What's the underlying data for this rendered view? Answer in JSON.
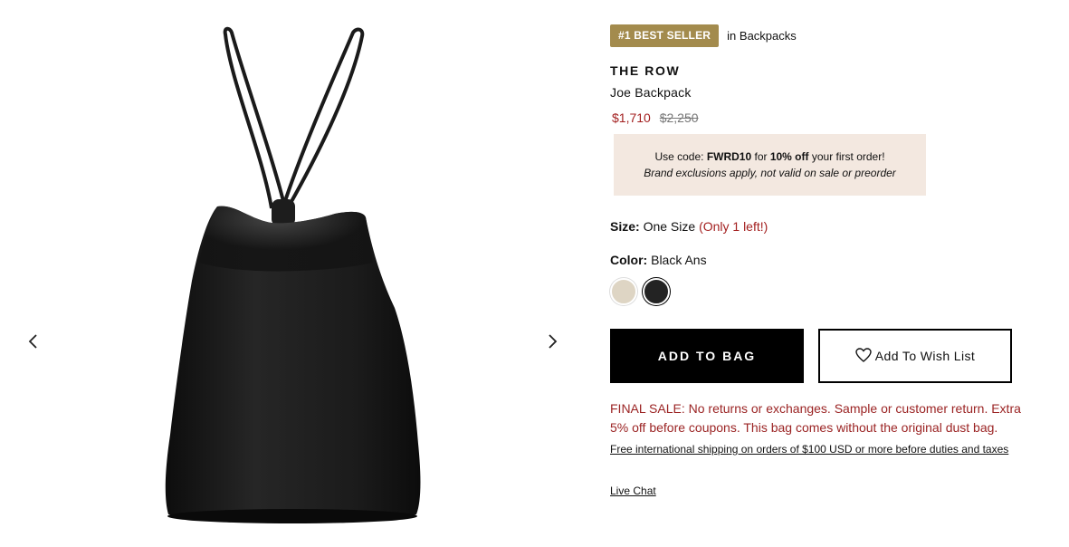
{
  "gallery": {
    "prev_icon": "chevron-left-icon",
    "next_icon": "chevron-right-icon"
  },
  "product": {
    "badge": "#1 BEST SELLER",
    "badge_category": "in Backpacks",
    "brand": "THE ROW",
    "name": "Joe Backpack",
    "price_sale": "$1,710",
    "price_original": "$2,250",
    "promo": {
      "prefix": "Use code: ",
      "code": "FWRD10",
      "middle": " for ",
      "discount": "10% off",
      "suffix": " your first order!",
      "note": "Brand exclusions apply, not valid on sale or preorder"
    },
    "size": {
      "label": "Size:",
      "value": "One Size",
      "stock": "(Only 1 left!)"
    },
    "color": {
      "label": "Color:",
      "value": "Black Ans",
      "swatches": [
        "#ded5c4",
        "#232323"
      ]
    },
    "add_to_bag": "ADD TO BAG",
    "wish_list": "Add To Wish List",
    "final_sale": "FINAL SALE: No returns or exchanges. Sample or customer return. Extra 5% off before coupons. This bag comes without the original dust bag.",
    "shipping": "Free international shipping on orders of $100 USD or more before duties and taxes",
    "live_chat": "Live Chat"
  },
  "colors": {
    "badge_gold": "#a38b4d",
    "sale_red": "#a31f1f",
    "promo_bg": "#f3e8e0"
  }
}
